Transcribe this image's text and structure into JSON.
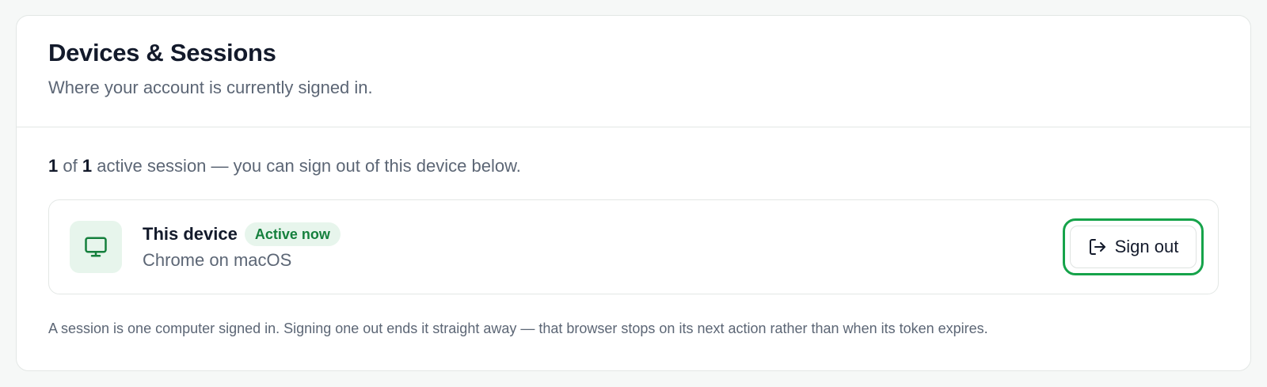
{
  "header": {
    "title": "Devices & Sessions",
    "subtitle": "Where your account is currently signed in."
  },
  "summary": {
    "active_count": "1",
    "of_label": "of",
    "total_count": "1",
    "text": "active session — you can sign out of this device below."
  },
  "session": {
    "icon": "monitor-icon",
    "name": "This device",
    "badge": "Active now",
    "detail": "Chrome on macOS",
    "signout_icon": "log-out-icon",
    "signout_label": "Sign out"
  },
  "footnote": "A session is one computer signed in. Signing one out ends it straight away — that browser stops on its next action rather than when its token expires.",
  "colors": {
    "accent": "#16a34a",
    "badge_text": "#15803d",
    "badge_bg": "#e7f5ec"
  }
}
